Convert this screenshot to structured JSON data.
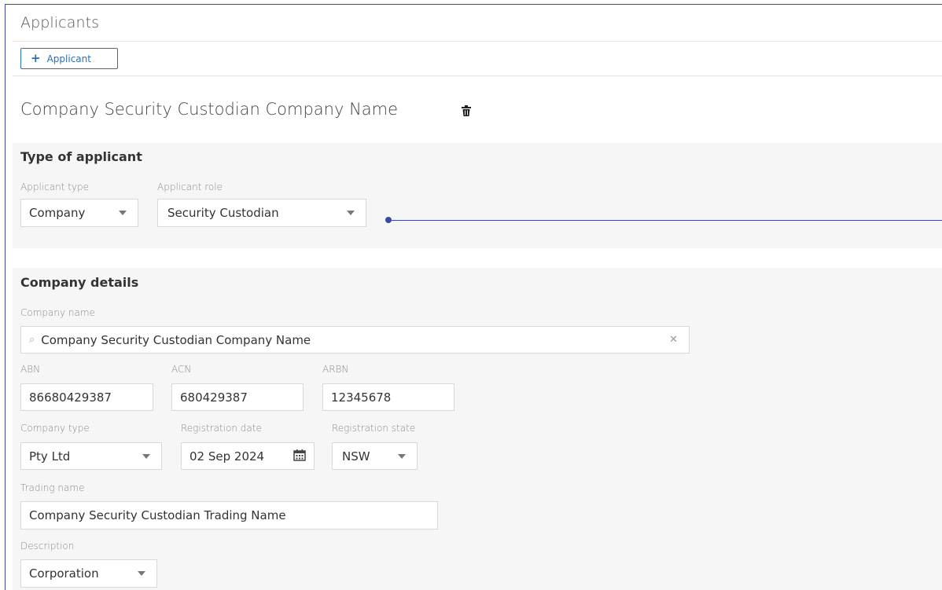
{
  "header": {
    "title": "Applicants",
    "add_button": "Applicant"
  },
  "applicant": {
    "name": "Company Security Custodian Company Name"
  },
  "type_section": {
    "title": "Type of applicant",
    "applicant_type_label": "Applicant type",
    "applicant_type_value": "Company",
    "applicant_role_label": "Applicant role",
    "applicant_role_value": "Security Custodian"
  },
  "company_section": {
    "title": "Company details",
    "company_name_label": "Company name",
    "company_name_value": "Company Security Custodian Company Name",
    "abn_label": "ABN",
    "abn_value": "86680429387",
    "acn_label": "ACN",
    "acn_value": "680429387",
    "arbn_label": "ARBN",
    "arbn_value": "12345678",
    "company_type_label": "Company type",
    "company_type_value": "Pty Ltd",
    "registration_date_label": "Registration date",
    "registration_date_value": "02 Sep 2024",
    "registration_state_label": "Registration state",
    "registration_state_value": "NSW",
    "trading_name_label": "Trading name",
    "trading_name_value": "Company Security Custodian Trading Name",
    "description_label": "Description",
    "description_value": "Corporation"
  },
  "icons": {
    "add": "plus-icon",
    "delete": "trash-icon",
    "search": "search-icon",
    "clear": "close-icon",
    "calendar": "calendar-icon",
    "dropdown": "chevron-down-icon"
  },
  "colors": {
    "accent": "#2c6fb0",
    "annotation": "#3b4aa0",
    "panel_bg": "#f6f6f6"
  }
}
